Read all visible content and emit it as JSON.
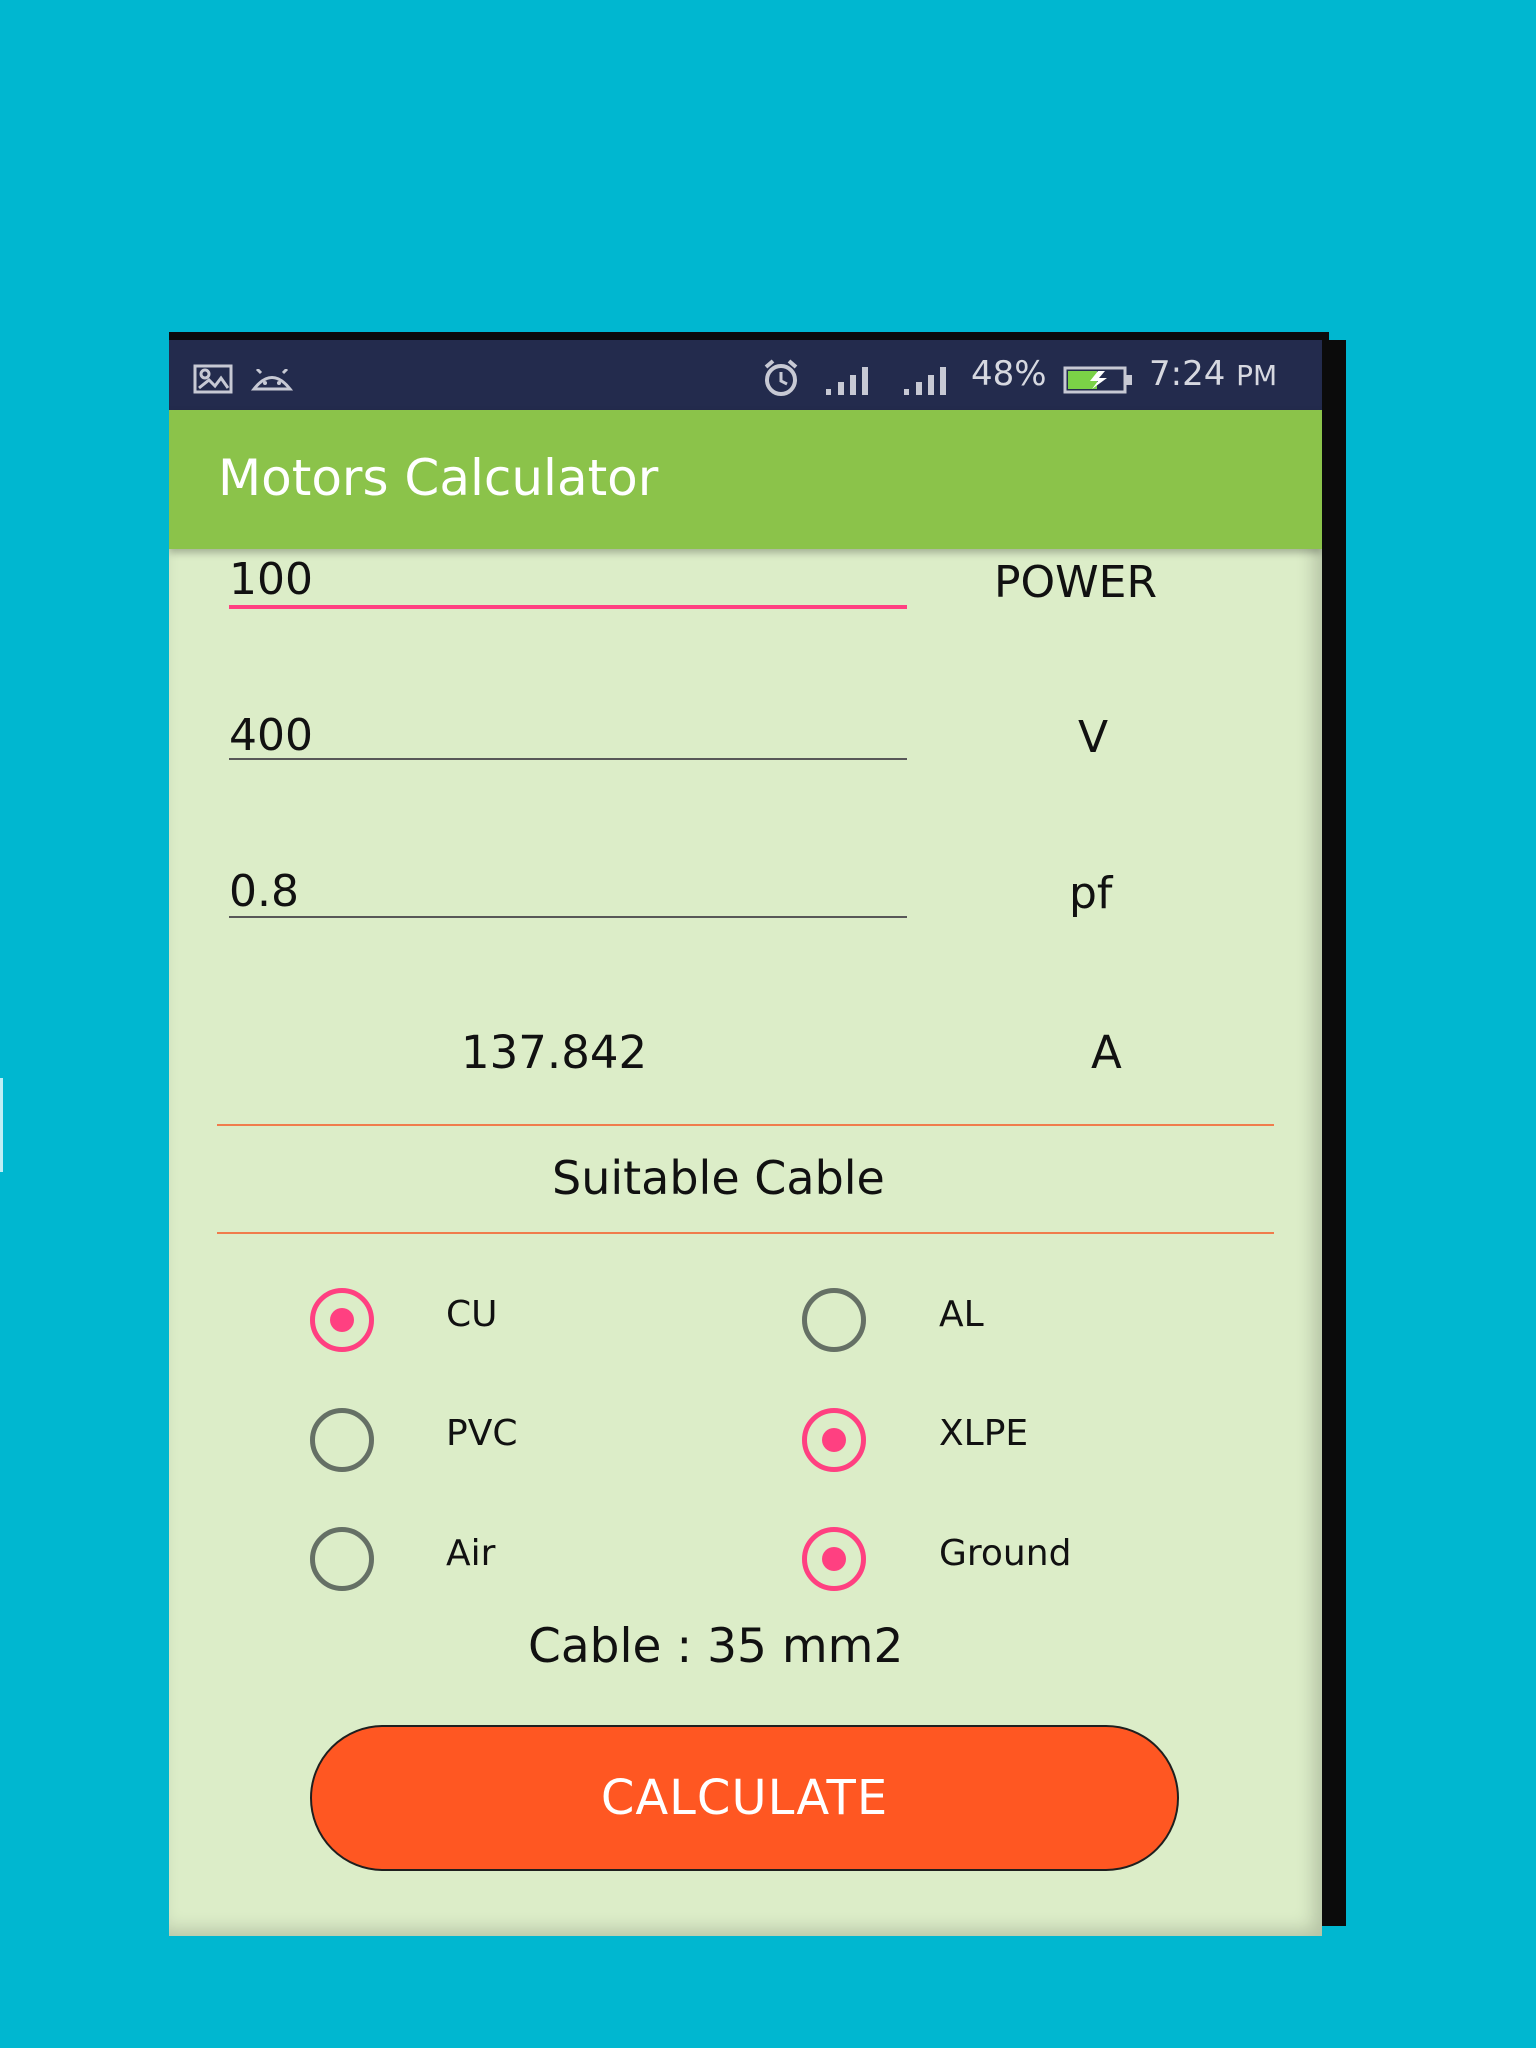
{
  "status_bar": {
    "icons": [
      "image-icon",
      "android-icon",
      "alarm-icon",
      "signal-icon",
      "signal-icon",
      "battery-charging-icon"
    ],
    "battery_percent": "48%",
    "time": "7:24",
    "meridiem": "PM"
  },
  "app_bar": {
    "title": "Motors Calculator"
  },
  "inputs": [
    {
      "value": "100",
      "unit": "POWER"
    },
    {
      "value": "400",
      "unit": "V"
    },
    {
      "value": "0.8",
      "unit": "pf"
    }
  ],
  "result": {
    "value": "137.842",
    "unit": "A"
  },
  "section": {
    "title": "Suitable Cable"
  },
  "options": {
    "cu": {
      "label": "CU",
      "checked": true
    },
    "al": {
      "label": "AL",
      "checked": false
    },
    "pvc": {
      "label": "PVC",
      "checked": false
    },
    "xlpe": {
      "label": "XLPE",
      "checked": true
    },
    "air": {
      "label": "Air",
      "checked": false
    },
    "ground": {
      "label": "Ground",
      "checked": true
    }
  },
  "cable": {
    "text": "Cable : 35 mm2"
  },
  "actions": {
    "calculate": "CALCULATE"
  },
  "colors": {
    "background": "#00b7d0",
    "status_bar": "#232b4d",
    "app_bar": "#8bc34a",
    "screen": "#dcedc8",
    "accent": "#ff4081",
    "button": "#ff5722",
    "divider": "#f07c4c"
  }
}
